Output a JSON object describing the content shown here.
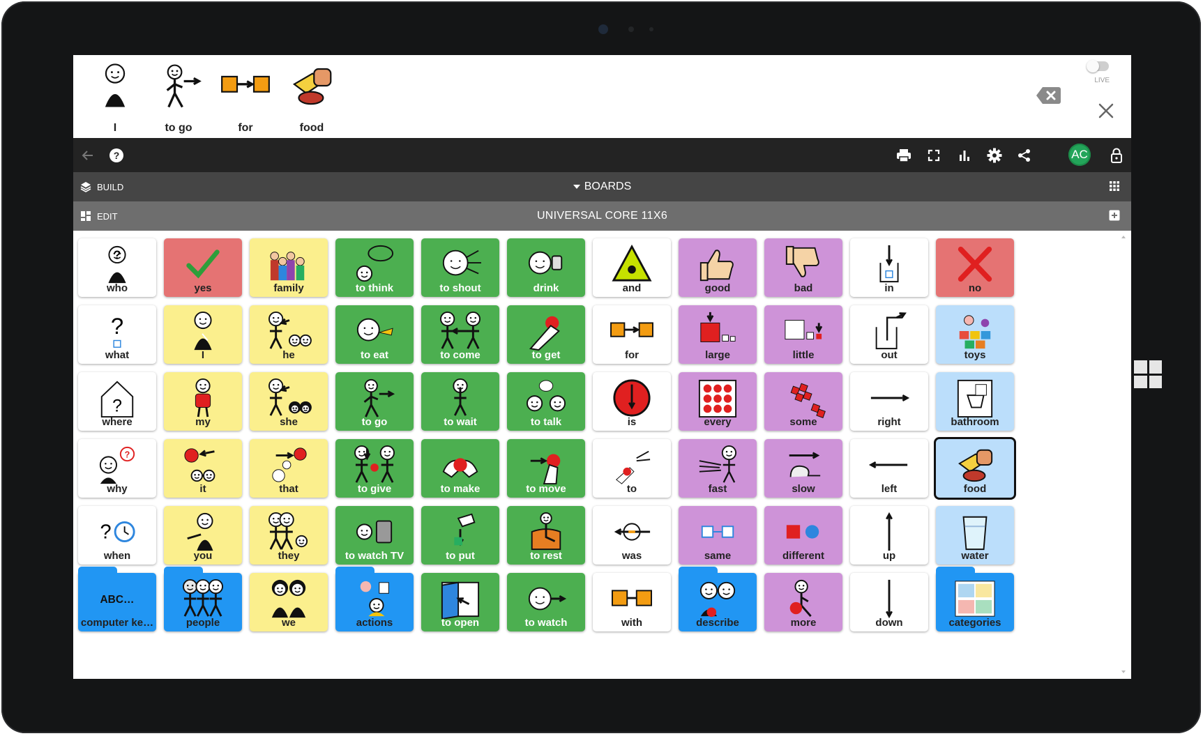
{
  "sentence": [
    {
      "label": "I",
      "icon": "person-self-icon"
    },
    {
      "label": "to go",
      "icon": "person-walking-icon"
    },
    {
      "label": "for",
      "icon": "for-arrow-icon"
    },
    {
      "label": "food",
      "icon": "food-icon"
    }
  ],
  "live_label": "LIVE",
  "toolbar": {
    "avatar_initials": "AC"
  },
  "build_bar": {
    "build_label": "BUILD",
    "boards_label": "BOARDS"
  },
  "edit_bar": {
    "edit_label": "EDIT",
    "board_title": "UNIVERSAL CORE 11X6"
  },
  "colors": {
    "green": "#4caf50",
    "yellow": "#fbef8d",
    "purple": "#ce93d8",
    "red": "#e57373",
    "lightblue": "#bbdefb",
    "folder_blue": "#2196f3",
    "avatar_green": "#23a55a"
  },
  "grid": [
    [
      {
        "label": "who",
        "color": "white",
        "icon": "who-icon"
      },
      {
        "label": "yes",
        "color": "red",
        "icon": "checkmark-icon"
      },
      {
        "label": "family",
        "color": "yellow",
        "icon": "family-icon"
      },
      {
        "label": "to think",
        "color": "green",
        "icon": "think-icon"
      },
      {
        "label": "to shout",
        "color": "green",
        "icon": "shout-icon"
      },
      {
        "label": "drink",
        "color": "green",
        "icon": "drink-icon"
      },
      {
        "label": "and",
        "color": "white",
        "icon": "and-icon"
      },
      {
        "label": "good",
        "color": "purple",
        "icon": "thumbs-up-icon"
      },
      {
        "label": "bad",
        "color": "purple",
        "icon": "thumbs-down-icon"
      },
      {
        "label": "in",
        "color": "white",
        "icon": "in-icon"
      },
      {
        "label": "no",
        "color": "red",
        "icon": "cross-icon"
      }
    ],
    [
      {
        "label": "what",
        "color": "white",
        "icon": "what-icon"
      },
      {
        "label": "I",
        "color": "yellow",
        "icon": "person-self-icon"
      },
      {
        "label": "he",
        "color": "yellow",
        "icon": "he-icon"
      },
      {
        "label": "to eat",
        "color": "green",
        "icon": "eat-icon"
      },
      {
        "label": "to come",
        "color": "green",
        "icon": "come-icon"
      },
      {
        "label": "to get",
        "color": "green",
        "icon": "get-icon"
      },
      {
        "label": "for",
        "color": "white",
        "icon": "for-arrow-icon"
      },
      {
        "label": "large",
        "color": "purple",
        "icon": "large-icon"
      },
      {
        "label": "little",
        "color": "purple",
        "icon": "little-icon"
      },
      {
        "label": "out",
        "color": "white",
        "icon": "out-icon"
      },
      {
        "label": "toys",
        "color": "lightblue",
        "icon": "toys-icon"
      }
    ],
    [
      {
        "label": "where",
        "color": "white",
        "icon": "where-icon"
      },
      {
        "label": "my",
        "color": "yellow",
        "icon": "my-icon"
      },
      {
        "label": "she",
        "color": "yellow",
        "icon": "she-icon"
      },
      {
        "label": "to go",
        "color": "green",
        "icon": "person-walking-icon"
      },
      {
        "label": "to wait",
        "color": "green",
        "icon": "wait-icon"
      },
      {
        "label": "to talk",
        "color": "green",
        "icon": "talk-icon"
      },
      {
        "label": "is",
        "color": "white",
        "icon": "is-icon"
      },
      {
        "label": "every",
        "color": "purple",
        "icon": "every-icon"
      },
      {
        "label": "some",
        "color": "purple",
        "icon": "some-icon"
      },
      {
        "label": "right",
        "color": "white",
        "icon": "arrow-right-icon"
      },
      {
        "label": "bathroom",
        "color": "lightblue",
        "icon": "bathroom-icon"
      }
    ],
    [
      {
        "label": "why",
        "color": "white",
        "icon": "why-icon"
      },
      {
        "label": "it",
        "color": "yellow",
        "icon": "it-icon"
      },
      {
        "label": "that",
        "color": "yellow",
        "icon": "that-icon"
      },
      {
        "label": "to give",
        "color": "green",
        "icon": "give-icon"
      },
      {
        "label": "to make",
        "color": "green",
        "icon": "make-icon"
      },
      {
        "label": "to move",
        "color": "green",
        "icon": "move-icon"
      },
      {
        "label": "to",
        "color": "white",
        "icon": "to-icon"
      },
      {
        "label": "fast",
        "color": "purple",
        "icon": "fast-icon"
      },
      {
        "label": "slow",
        "color": "purple",
        "icon": "slow-icon"
      },
      {
        "label": "left",
        "color": "white",
        "icon": "arrow-left-icon"
      },
      {
        "label": "food",
        "color": "lightblue",
        "icon": "food-icon",
        "selected": true
      }
    ],
    [
      {
        "label": "when",
        "color": "white",
        "icon": "when-icon"
      },
      {
        "label": "you",
        "color": "yellow",
        "icon": "you-icon"
      },
      {
        "label": "they",
        "color": "yellow",
        "icon": "they-icon"
      },
      {
        "label": "to watch TV",
        "color": "green",
        "icon": "watch-tv-icon"
      },
      {
        "label": "to put",
        "color": "green",
        "icon": "put-icon"
      },
      {
        "label": "to rest",
        "color": "green",
        "icon": "rest-icon"
      },
      {
        "label": "was",
        "color": "white",
        "icon": "was-icon"
      },
      {
        "label": "same",
        "color": "purple",
        "icon": "same-icon"
      },
      {
        "label": "different",
        "color": "purple",
        "icon": "different-icon"
      },
      {
        "label": "up",
        "color": "white",
        "icon": "arrow-up-icon"
      },
      {
        "label": "water",
        "color": "lightblue",
        "icon": "water-glass-icon"
      }
    ],
    [
      {
        "label": "computer ke…",
        "color": "folder",
        "icon": "keyboard-text-icon",
        "symbol_text": "ABC…"
      },
      {
        "label": "people",
        "color": "folder",
        "icon": "people-icon"
      },
      {
        "label": "we",
        "color": "yellow",
        "icon": "we-icon"
      },
      {
        "label": "actions",
        "color": "folder",
        "icon": "actions-icon"
      },
      {
        "label": "to open",
        "color": "green",
        "icon": "open-door-icon"
      },
      {
        "label": "to watch",
        "color": "green",
        "icon": "watch-icon"
      },
      {
        "label": "with",
        "color": "white",
        "icon": "with-icon"
      },
      {
        "label": "describe",
        "color": "folder",
        "icon": "describe-icon"
      },
      {
        "label": "more",
        "color": "purple",
        "icon": "more-icon"
      },
      {
        "label": "down",
        "color": "white",
        "icon": "arrow-down-icon"
      },
      {
        "label": "categories",
        "color": "folder",
        "icon": "categories-icon"
      }
    ]
  ]
}
